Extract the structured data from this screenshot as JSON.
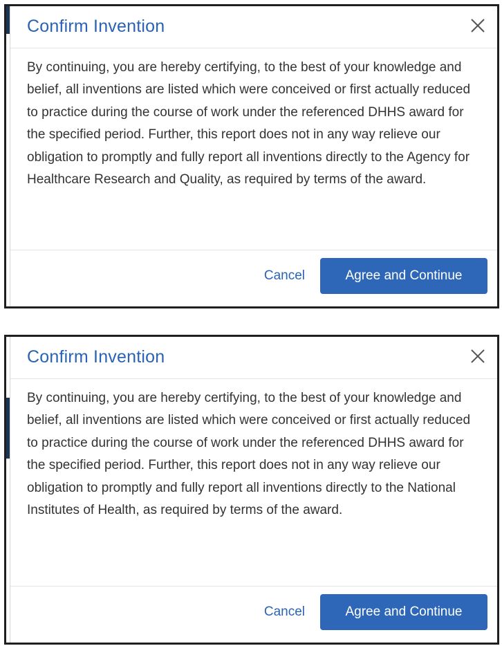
{
  "dialogs": [
    {
      "title": "Confirm Invention",
      "close_icon": "close-icon",
      "body": "By continuing, you are hereby certifying, to the best of your knowledge and belief, all inventions are listed which were conceived or first actually reduced to practice during the course of work under the referenced DHHS award for the specified period. Further, this report does not in any way relieve our obligation to promptly and fully report all inventions directly to the Agency for Healthcare Research and Quality, as required by terms of the award.",
      "cancel_label": "Cancel",
      "confirm_label": "Agree and Continue"
    },
    {
      "title": "Confirm Invention",
      "close_icon": "close-icon",
      "body": "By continuing, you are hereby certifying, to the best of your knowledge and belief, all inventions are listed which were conceived or first actually reduced to practice during the course of work under the referenced DHHS award for the specified period. Further, this report does not in any way relieve our obligation to promptly and fully report all inventions directly to the National Institutes of Health, as required by terms of the award.",
      "cancel_label": "Cancel",
      "confirm_label": "Agree and Continue"
    }
  ],
  "colors": {
    "accent": "#2a63b3",
    "button": "#2e67b8",
    "text": "#333333"
  }
}
